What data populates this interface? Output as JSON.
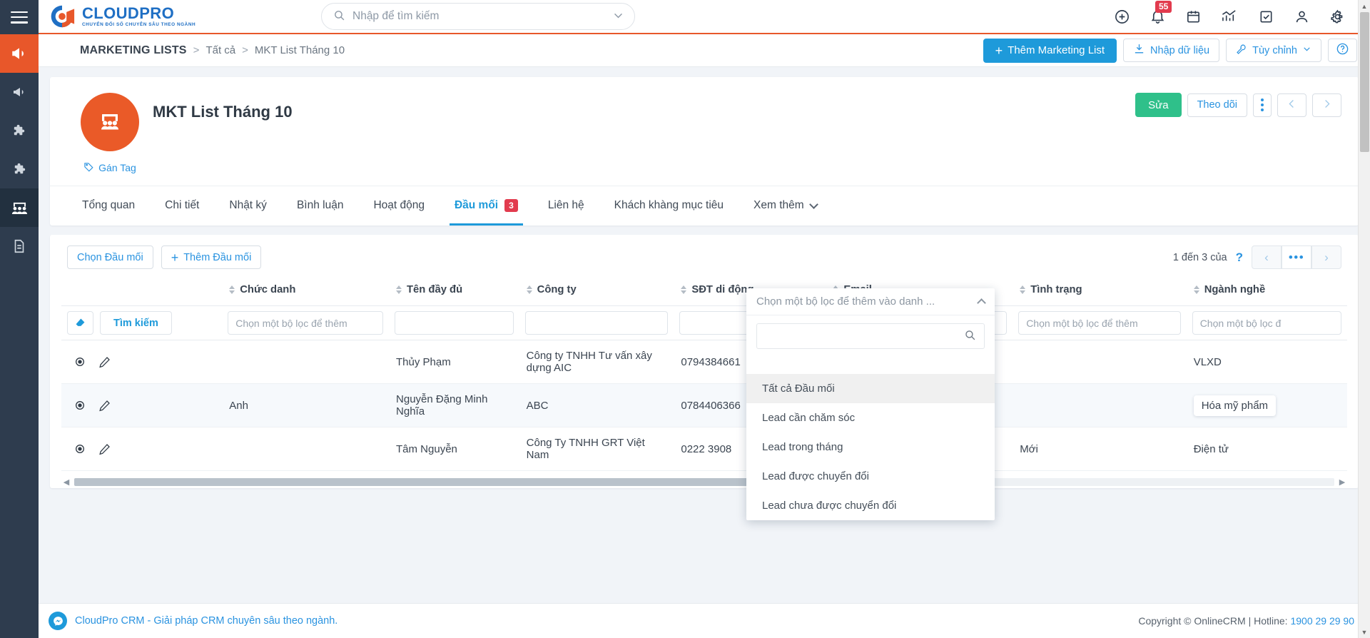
{
  "brand": {
    "name": "CLOUDPRO",
    "tagline": "CHUYỂN ĐỔI SỐ CHUYÊN SÂU THEO NGÀNH",
    "accent_color": "#e8572a",
    "primary_color": "#1e9ada"
  },
  "rail": {
    "menu_icon": "hamburger-icon",
    "items": [
      {
        "name": "megaphone-icon",
        "label": "Marketing"
      },
      {
        "name": "megaphone-alt-icon",
        "label": "Chiến dịch"
      },
      {
        "name": "puzzle-icon",
        "label": "Tiện ích"
      },
      {
        "name": "puzzle-alt-icon",
        "label": "Tiện ích mở rộng"
      },
      {
        "name": "people-icon",
        "label": "Marketing Lists"
      },
      {
        "name": "document-icon",
        "label": "Tài liệu"
      }
    ]
  },
  "search": {
    "placeholder": "Nhập để tìm kiếm",
    "value": "",
    "icon": "search-icon",
    "chevron": "chevron-down-icon"
  },
  "topbar_icons": [
    {
      "name": "plus-circle-icon",
      "label": "Thêm nhanh",
      "badge": ""
    },
    {
      "name": "bell-icon",
      "label": "Thông báo",
      "badge": "55"
    },
    {
      "name": "calendar-icon",
      "label": "Lịch",
      "badge": ""
    },
    {
      "name": "chart-icon",
      "label": "Báo cáo",
      "badge": ""
    },
    {
      "name": "checkbox-icon",
      "label": "Công việc",
      "badge": ""
    },
    {
      "name": "user-icon",
      "label": "Tài khoản",
      "badge": ""
    },
    {
      "name": "gear-icon",
      "label": "Cài đặt",
      "badge": ""
    }
  ],
  "breadcrumb": {
    "module": "MARKETING LISTS",
    "sep": ">",
    "parent": "Tất cả",
    "current": "MKT List Tháng 10"
  },
  "header_actions": {
    "add_label": "Thêm Marketing List",
    "import_label": "Nhập dữ liệu",
    "customize_label": "Tùy chỉnh",
    "help_label": "?"
  },
  "record": {
    "title": "MKT List Tháng 10",
    "avatar_icon": "audience-people-icon",
    "avatar_color": "#ea5a28",
    "tag_label": "Gán Tag",
    "tag_icon": "tag-icon",
    "edit_label": "Sửa",
    "follow_label": "Theo dõi",
    "more_icon": "kebab-menu-icon",
    "prev_icon": "chevron-left-icon",
    "next_icon": "chevron-right-icon"
  },
  "tabs": [
    {
      "label": "Tổng quan",
      "badge": "",
      "active": false
    },
    {
      "label": "Chi tiết",
      "badge": "",
      "active": false
    },
    {
      "label": "Nhật ký",
      "badge": "",
      "active": false
    },
    {
      "label": "Bình luận",
      "badge": "",
      "active": false
    },
    {
      "label": "Hoạt động",
      "badge": "",
      "active": false
    },
    {
      "label": "Đầu mối",
      "badge": "3",
      "active": true
    },
    {
      "label": "Liên hệ",
      "badge": "",
      "active": false
    },
    {
      "label": "Khách khàng mục tiêu",
      "badge": "",
      "active": false
    },
    {
      "label": "Xem thêm",
      "badge": "",
      "active": false,
      "chevron": true
    }
  ],
  "panel_toolbar": {
    "select_lead_label": "Chọn Đầu mối",
    "add_lead_label": "Thêm Đầu mối",
    "pagination_text": "1 đến 3 của",
    "pagination_help": "?",
    "pager_prev": "‹",
    "pager_mid": "•••",
    "pager_next": "›"
  },
  "table": {
    "search_button": "Tìm kiếm",
    "eraser_icon": "eraser-icon",
    "view_icon": "eye-icon",
    "edit_icon": "pencil-icon",
    "filter_placeholder": "Chọn một bộ lọc để thêm",
    "columns": [
      {
        "label": "",
        "sortable": false
      },
      {
        "label": "Chức danh",
        "sortable": true
      },
      {
        "label": "Tên đầy đủ",
        "sortable": true
      },
      {
        "label": "Công ty",
        "sortable": true
      },
      {
        "label": "SĐT di động",
        "sortable": true
      },
      {
        "label": "Email",
        "sortable": true
      },
      {
        "label": "Tình trạng",
        "sortable": true
      },
      {
        "label": "Ngành nghề",
        "sortable": true
      }
    ],
    "filters": [
      "",
      "Chọn một bộ lọc để thêm",
      "",
      "",
      "",
      "",
      "Chọn một bộ lọc để thêm",
      "Chọn một bộ lọc đ"
    ],
    "rows": [
      {
        "chuc_danh": "",
        "ten_day_du": "Thủy Phạm",
        "cong_ty": "Công ty TNHH Tư vấn xây dựng AIC",
        "sdt": "0794384661",
        "email": "",
        "tinh_trang": "",
        "nganh_nghe": "VLXD",
        "nganh_nghe_boxed": false
      },
      {
        "chuc_danh": "Anh",
        "ten_day_du": "Nguyễn Đặng Minh Nghĩa",
        "cong_ty": "ABC",
        "sdt": "0784406366",
        "email": "",
        "tinh_trang": "",
        "nganh_nghe": "Hóa mỹ phẩm",
        "nganh_nghe_boxed": true
      },
      {
        "chuc_danh": "",
        "ten_day_du": "Tâm Nguyễn",
        "cong_ty": "Công Ty TNHH GRT Việt Nam",
        "sdt": "0222 3908",
        "email": "",
        "tinh_trang": "Mới",
        "nganh_nghe": "Điện tử",
        "nganh_nghe_boxed": false
      }
    ]
  },
  "dropdown": {
    "header": "Chọn một bộ lọc để thêm vào danh ...",
    "collapse_icon": "chevron-up-icon",
    "search_value": "",
    "search_icon": "search-icon",
    "options": [
      {
        "label": "Tất cả Đầu mối",
        "highlighted": true
      },
      {
        "label": "Lead cần chăm sóc",
        "highlighted": false
      },
      {
        "label": "Lead trong tháng",
        "highlighted": false
      },
      {
        "label": "Lead được chuyển đổi",
        "highlighted": false
      },
      {
        "label": "Lead chưa được chuyển đổi",
        "highlighted": false
      }
    ]
  },
  "footer": {
    "messenger_icon": "messenger-icon",
    "link": "CloudPro CRM - Giải pháp CRM chuyên sâu theo ngành.",
    "copyright": "Copyright © OnlineCRM | Hotline: ",
    "hotline": "1900 29 29 90"
  }
}
